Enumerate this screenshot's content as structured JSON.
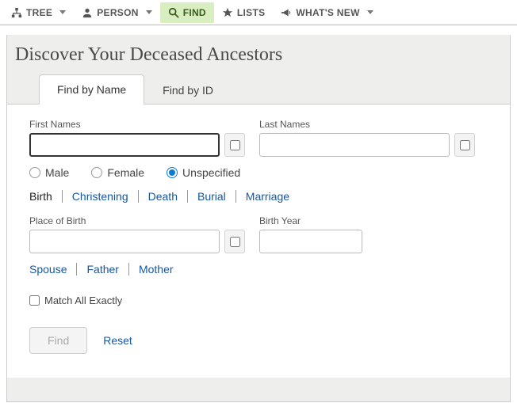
{
  "nav": {
    "tree": "TREE",
    "person": "PERSON",
    "find": "FIND",
    "lists": "LISTS",
    "whatsnew": "WHAT'S NEW"
  },
  "title": "Discover Your Deceased Ancestors",
  "tabs": {
    "byname": "Find by Name",
    "byid": "Find by ID"
  },
  "labels": {
    "first_names": "First Names",
    "last_names": "Last Names",
    "place_of_birth": "Place of Birth",
    "birth_year": "Birth Year",
    "match_all": "Match All Exactly"
  },
  "radios": {
    "male": "Male",
    "female": "Female",
    "unspecified": "Unspecified"
  },
  "events": {
    "birth": "Birth",
    "christening": "Christening",
    "death": "Death",
    "burial": "Burial",
    "marriage": "Marriage"
  },
  "relatives": {
    "spouse": "Spouse",
    "father": "Father",
    "mother": "Mother"
  },
  "actions": {
    "find": "Find",
    "reset": "Reset"
  },
  "values": {
    "first_names": "",
    "last_names": "",
    "place_of_birth": "",
    "birth_year": ""
  }
}
